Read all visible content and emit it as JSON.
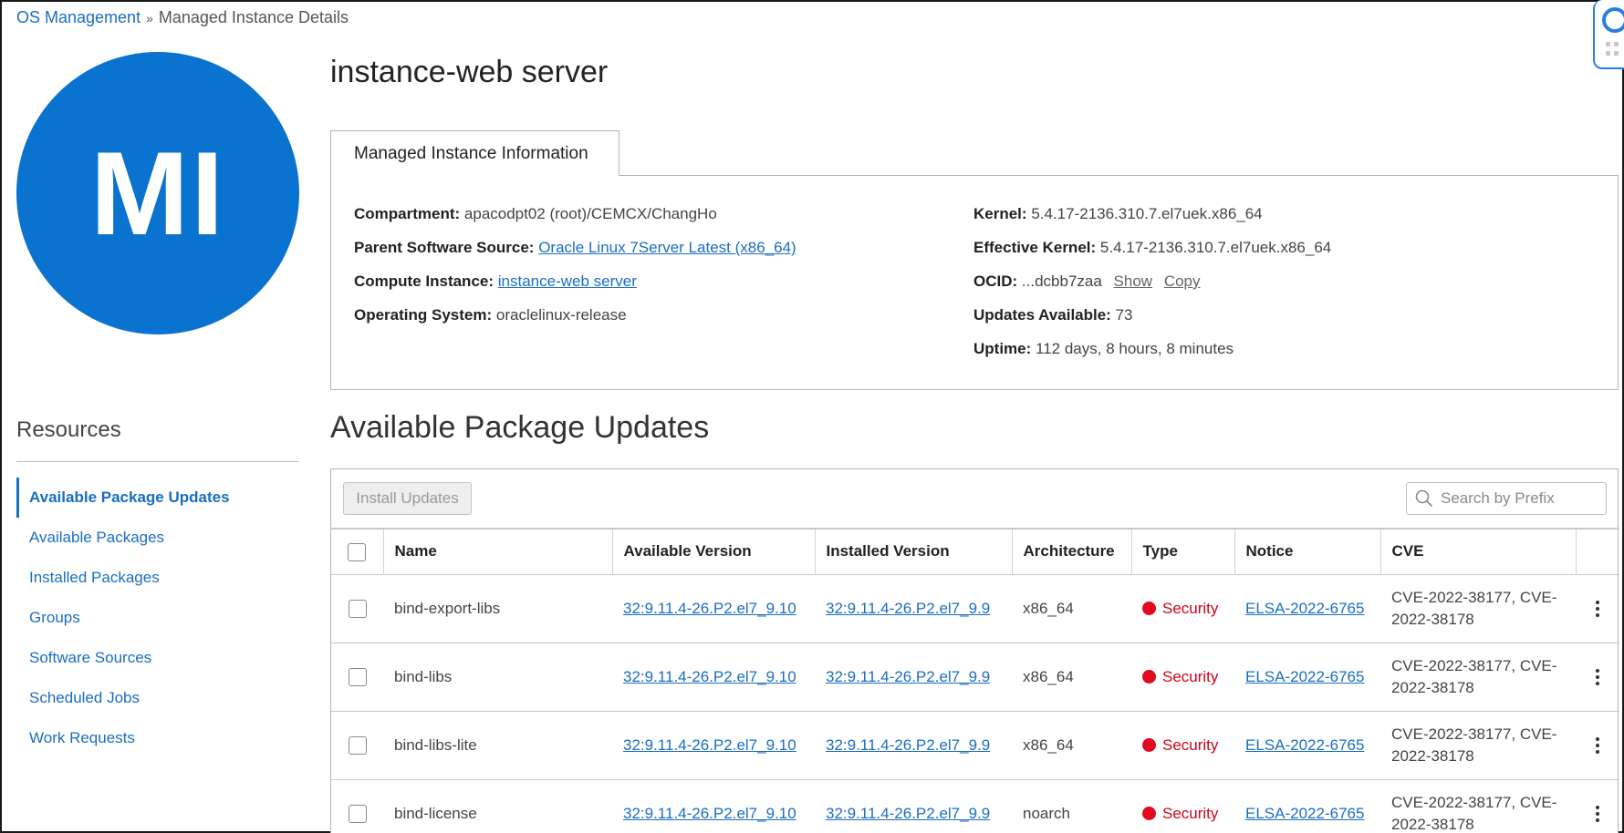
{
  "breadcrumb": {
    "root": "OS Management",
    "separator": "»",
    "current": "Managed Instance Details"
  },
  "avatar": {
    "initials": "MI",
    "color": "#0a72cf"
  },
  "page_title": "instance-web server",
  "info": {
    "tab_label": "Managed Instance Information",
    "left": [
      {
        "label": "Compartment:",
        "value": "apacodpt02 (root)/CEMCX/ChangHo",
        "link": false
      },
      {
        "label": "Parent Software Source:",
        "value": "Oracle Linux 7Server Latest (x86_64)",
        "link": true
      },
      {
        "label": "Compute Instance:",
        "value": "instance-web server",
        "link": true
      },
      {
        "label": "Operating System:",
        "value": "oraclelinux-release",
        "link": false
      }
    ],
    "right": {
      "kernel_label": "Kernel:",
      "kernel": "5.4.17-2136.310.7.el7uek.x86_64",
      "eff_kernel_label": "Effective Kernel:",
      "eff_kernel": "5.4.17-2136.310.7.el7uek.x86_64",
      "ocid_label": "OCID:",
      "ocid": "...dcbb7zaa",
      "ocid_show": "Show",
      "ocid_copy": "Copy",
      "updates_label": "Updates Available:",
      "updates": "73",
      "uptime_label": "Uptime:",
      "uptime": "112 days, 8 hours, 8 minutes"
    }
  },
  "resources": {
    "title": "Resources",
    "items": [
      {
        "label": "Available Package Updates",
        "active": true
      },
      {
        "label": "Available Packages",
        "active": false
      },
      {
        "label": "Installed Packages",
        "active": false
      },
      {
        "label": "Groups",
        "active": false
      },
      {
        "label": "Software Sources",
        "active": false
      },
      {
        "label": "Scheduled Jobs",
        "active": false
      },
      {
        "label": "Work Requests",
        "active": false
      }
    ]
  },
  "updates": {
    "title": "Available Package Updates",
    "install_button": "Install Updates",
    "search_placeholder": "Search by Prefix",
    "columns": {
      "name": "Name",
      "available": "Available Version",
      "installed": "Installed Version",
      "arch": "Architecture",
      "type": "Type",
      "notice": "Notice",
      "cve": "CVE"
    },
    "rows": [
      {
        "name": "bind-export-libs",
        "available": "32:9.11.4-26.P2.el7_9.10",
        "installed": "32:9.11.4-26.P2.el7_9.9",
        "arch": "x86_64",
        "type": "Security",
        "notice": "ELSA-2022-6765",
        "cve": "CVE-2022-38177, CVE-2022-38178"
      },
      {
        "name": "bind-libs",
        "available": "32:9.11.4-26.P2.el7_9.10",
        "installed": "32:9.11.4-26.P2.el7_9.9",
        "arch": "x86_64",
        "type": "Security",
        "notice": "ELSA-2022-6765",
        "cve": "CVE-2022-38177, CVE-2022-38178"
      },
      {
        "name": "bind-libs-lite",
        "available": "32:9.11.4-26.P2.el7_9.10",
        "installed": "32:9.11.4-26.P2.el7_9.9",
        "arch": "x86_64",
        "type": "Security",
        "notice": "ELSA-2022-6765",
        "cve": "CVE-2022-38177, CVE-2022-38178"
      },
      {
        "name": "bind-license",
        "available": "32:9.11.4-26.P2.el7_9.10",
        "installed": "32:9.11.4-26.P2.el7_9.9",
        "arch": "noarch",
        "type": "Security",
        "notice": "ELSA-2022-6765",
        "cve": "CVE-2022-38177, CVE-2022-38178"
      }
    ]
  },
  "colors": {
    "accent": "#1a6ec1",
    "security": "#e00b1f"
  }
}
